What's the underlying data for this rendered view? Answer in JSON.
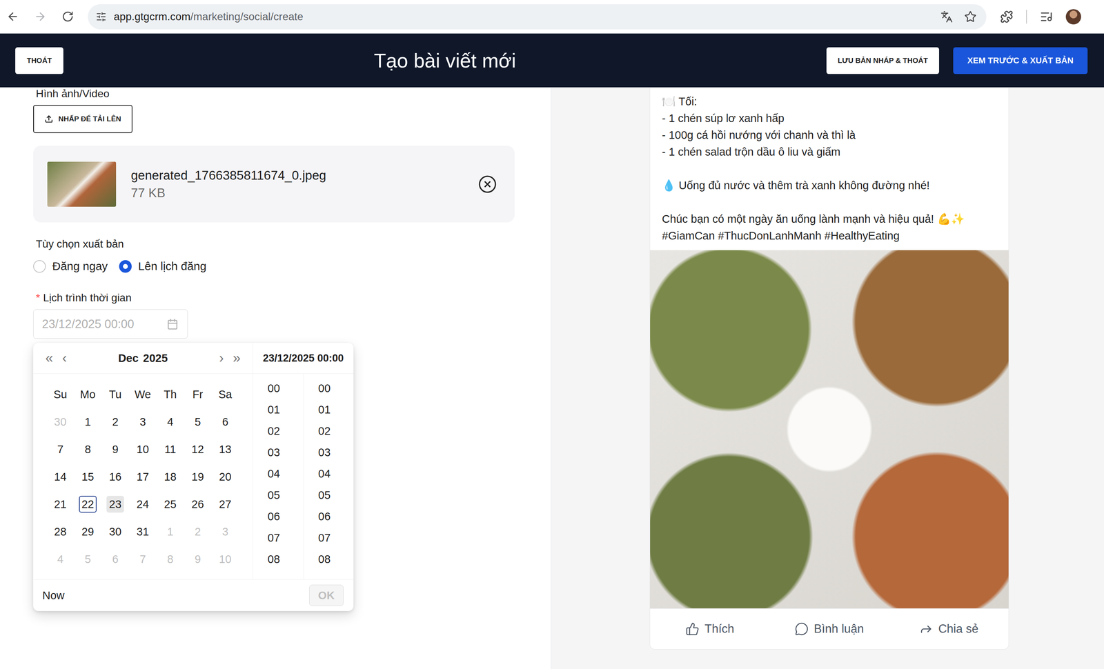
{
  "browser": {
    "url_host": "app.gtgcrm.com",
    "url_path": "/marketing/social/create"
  },
  "header": {
    "exit": "THOÁT",
    "title": "Tạo bài viết mới",
    "save_draft": "LƯU BẢN NHÁP & THOÁT",
    "publish": "XEM TRƯỚC & XUẤT BẢN"
  },
  "media": {
    "label": "Hình ảnh/Video",
    "upload": "NHẤP ĐỂ TẢI LÊN",
    "files": [
      {
        "name": "generated_1766385811674_0.jpeg",
        "size": "77 KB"
      }
    ]
  },
  "publish_options": {
    "label": "Tùy chọn xuất bản",
    "options": [
      {
        "label": "Đăng ngay",
        "selected": false
      },
      {
        "label": "Lên lịch đăng",
        "selected": true
      }
    ]
  },
  "schedule": {
    "required_mark": "*",
    "label": "Lịch trình thời gian",
    "value": "23/12/2025 00:00"
  },
  "picker": {
    "prev_year": "«",
    "prev_month": "‹",
    "next_month": "›",
    "next_year": "»",
    "month": "Dec",
    "year": "2025",
    "selected_value": "23/12/2025 00:00",
    "weekdays": [
      "Su",
      "Mo",
      "Tu",
      "We",
      "Th",
      "Fr",
      "Sa"
    ],
    "weeks": [
      [
        {
          "day": "30",
          "in_month": false,
          "today": false,
          "hovered": false
        },
        {
          "day": "1",
          "in_month": true,
          "today": false,
          "hovered": false
        },
        {
          "day": "2",
          "in_month": true,
          "today": false,
          "hovered": false
        },
        {
          "day": "3",
          "in_month": true,
          "today": false,
          "hovered": false
        },
        {
          "day": "4",
          "in_month": true,
          "today": false,
          "hovered": false
        },
        {
          "day": "5",
          "in_month": true,
          "today": false,
          "hovered": false
        },
        {
          "day": "6",
          "in_month": true,
          "today": false,
          "hovered": false
        }
      ],
      [
        {
          "day": "7",
          "in_month": true,
          "today": false,
          "hovered": false
        },
        {
          "day": "8",
          "in_month": true,
          "today": false,
          "hovered": false
        },
        {
          "day": "9",
          "in_month": true,
          "today": false,
          "hovered": false
        },
        {
          "day": "10",
          "in_month": true,
          "today": false,
          "hovered": false
        },
        {
          "day": "11",
          "in_month": true,
          "today": false,
          "hovered": false
        },
        {
          "day": "12",
          "in_month": true,
          "today": false,
          "hovered": false
        },
        {
          "day": "13",
          "in_month": true,
          "today": false,
          "hovered": false
        }
      ],
      [
        {
          "day": "14",
          "in_month": true,
          "today": false,
          "hovered": false
        },
        {
          "day": "15",
          "in_month": true,
          "today": false,
          "hovered": false
        },
        {
          "day": "16",
          "in_month": true,
          "today": false,
          "hovered": false
        },
        {
          "day": "17",
          "in_month": true,
          "today": false,
          "hovered": false
        },
        {
          "day": "18",
          "in_month": true,
          "today": false,
          "hovered": false
        },
        {
          "day": "19",
          "in_month": true,
          "today": false,
          "hovered": false
        },
        {
          "day": "20",
          "in_month": true,
          "today": false,
          "hovered": false
        }
      ],
      [
        {
          "day": "21",
          "in_month": true,
          "today": false,
          "hovered": false
        },
        {
          "day": "22",
          "in_month": true,
          "today": true,
          "hovered": false
        },
        {
          "day": "23",
          "in_month": true,
          "today": false,
          "hovered": true
        },
        {
          "day": "24",
          "in_month": true,
          "today": false,
          "hovered": false
        },
        {
          "day": "25",
          "in_month": true,
          "today": false,
          "hovered": false
        },
        {
          "day": "26",
          "in_month": true,
          "today": false,
          "hovered": false
        },
        {
          "day": "27",
          "in_month": true,
          "today": false,
          "hovered": false
        }
      ],
      [
        {
          "day": "28",
          "in_month": true,
          "today": false,
          "hovered": false
        },
        {
          "day": "29",
          "in_month": true,
          "today": false,
          "hovered": false
        },
        {
          "day": "30",
          "in_month": true,
          "today": false,
          "hovered": false
        },
        {
          "day": "31",
          "in_month": true,
          "today": false,
          "hovered": false
        },
        {
          "day": "1",
          "in_month": false,
          "today": false,
          "hovered": false
        },
        {
          "day": "2",
          "in_month": false,
          "today": false,
          "hovered": false
        },
        {
          "day": "3",
          "in_month": false,
          "today": false,
          "hovered": false
        }
      ],
      [
        {
          "day": "4",
          "in_month": false,
          "today": false,
          "hovered": false
        },
        {
          "day": "5",
          "in_month": false,
          "today": false,
          "hovered": false
        },
        {
          "day": "6",
          "in_month": false,
          "today": false,
          "hovered": false
        },
        {
          "day": "7",
          "in_month": false,
          "today": false,
          "hovered": false
        },
        {
          "day": "8",
          "in_month": false,
          "today": false,
          "hovered": false
        },
        {
          "day": "9",
          "in_month": false,
          "today": false,
          "hovered": false
        },
        {
          "day": "10",
          "in_month": false,
          "today": false,
          "hovered": false
        }
      ]
    ],
    "hours": [
      "00",
      "01",
      "02",
      "03",
      "04",
      "05",
      "06",
      "07",
      "08"
    ],
    "minutes": [
      "00",
      "01",
      "02",
      "03",
      "04",
      "05",
      "06",
      "07",
      "08"
    ],
    "now": "Now",
    "ok": "OK",
    "ok_disabled": true
  },
  "preview": {
    "paragraphs": [
      [
        "🍽️ Tối:",
        "- 1 chén súp lơ xanh hấp",
        "- 100g cá hồi nướng với chanh và thì là",
        "- 1 chén salad trộn dầu ô liu và giấm"
      ],
      [
        "💧 Uống đủ nước và thêm trà xanh không đường nhé!"
      ],
      [
        "Chúc bạn có một ngày ăn uống lành mạnh và hiệu quả! 💪✨",
        "#GiamCan #ThucDonLanhManh #HealthyEating"
      ]
    ],
    "actions": [
      {
        "kind": "like",
        "label": "Thích"
      },
      {
        "kind": "comment",
        "label": "Bình luận"
      },
      {
        "kind": "share",
        "label": "Chia sẻ"
      }
    ]
  }
}
